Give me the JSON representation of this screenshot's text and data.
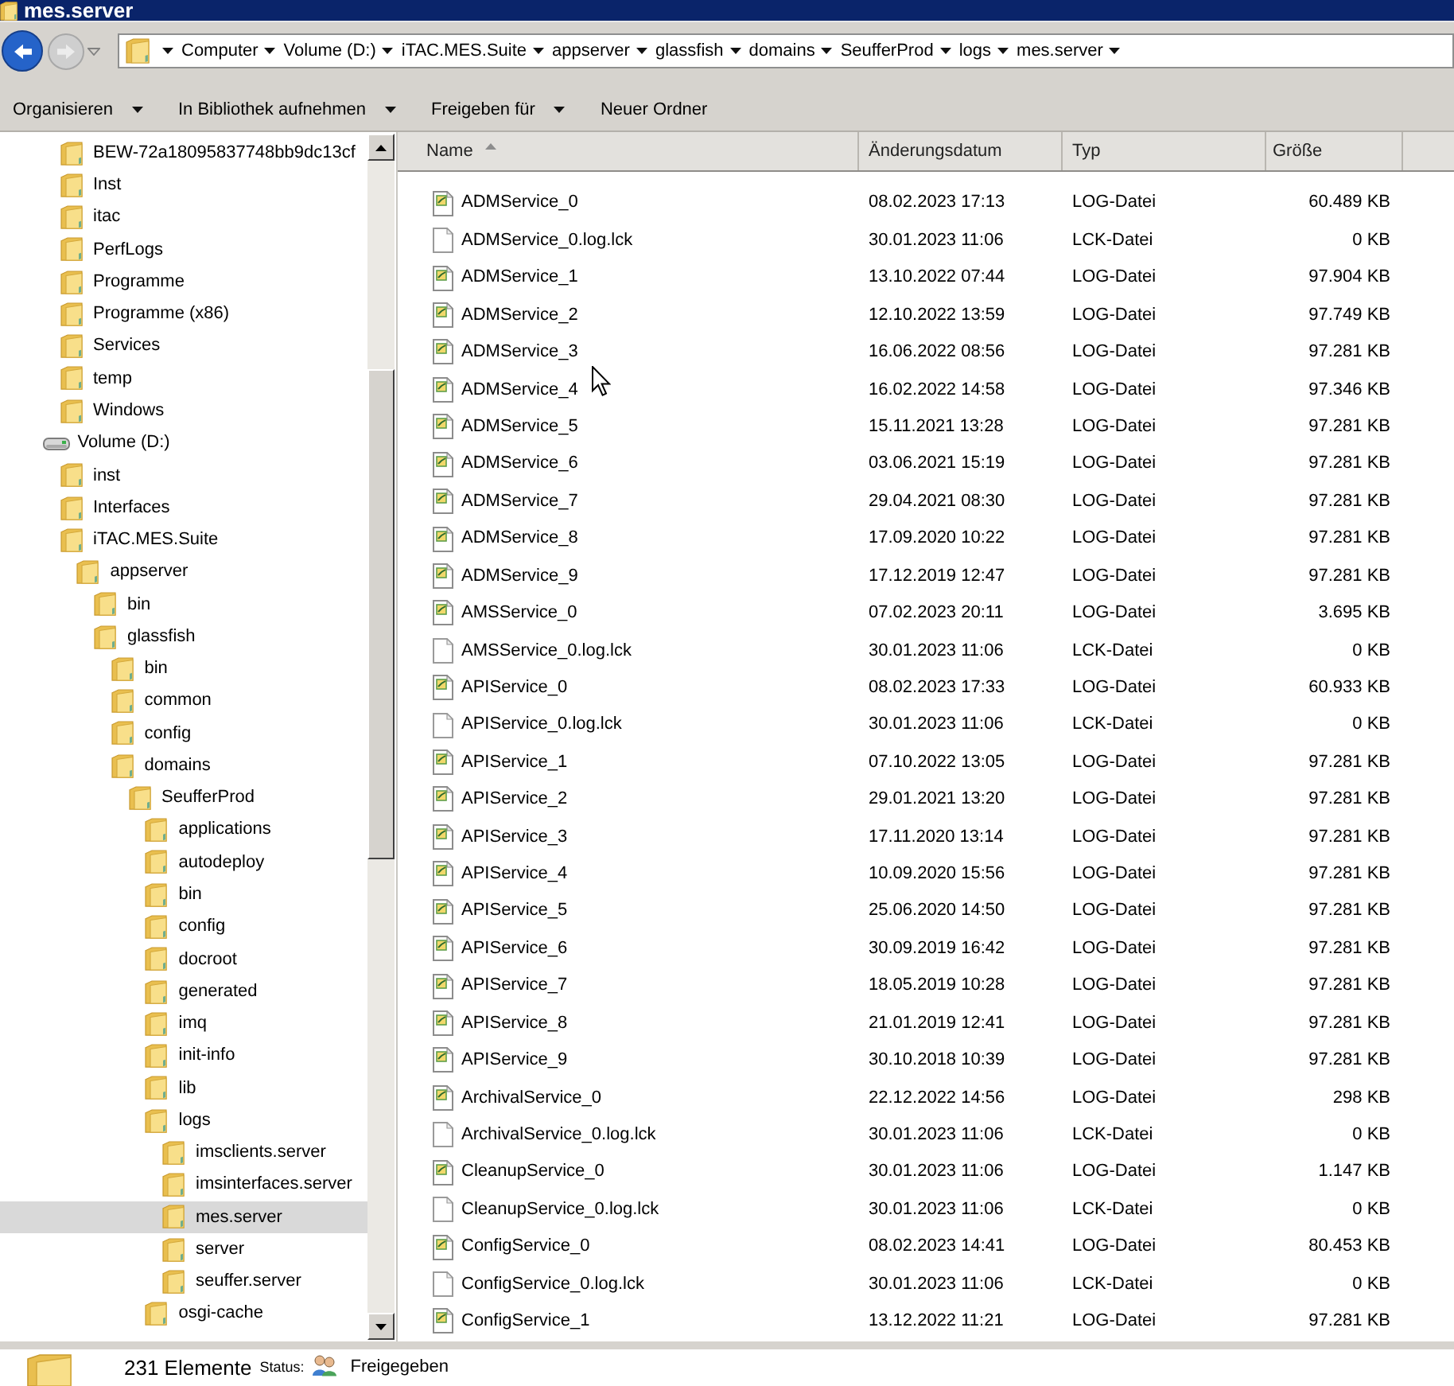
{
  "window": {
    "title": "mes.server"
  },
  "navigation": {
    "back": {
      "disabled": false
    },
    "forward": {
      "disabled": true
    }
  },
  "address_bar": {
    "breadcrumbs": [
      "Computer",
      "Volume (D:)",
      "iTAC.MES.Suite",
      "appserver",
      "glassfish",
      "domains",
      "SeufferProd",
      "logs",
      "mes.server"
    ]
  },
  "toolbar": [
    {
      "label": "Organisieren",
      "dropdown": true
    },
    {
      "label": "In Bibliothek aufnehmen",
      "dropdown": true
    },
    {
      "label": "Freigeben für",
      "dropdown": true
    },
    {
      "label": "Neuer Ordner",
      "dropdown": false
    }
  ],
  "navigation_pane": {
    "partial_children": [
      {
        "label": "BEW-72a18095837748bb9dc13cf",
        "kind": "folder",
        "selected": false
      },
      {
        "label": "Inst",
        "kind": "folder",
        "selected": false
      },
      {
        "label": "itac",
        "kind": "folder",
        "selected": false
      },
      {
        "label": "PerfLogs",
        "kind": "folder",
        "selected": false
      },
      {
        "label": "Programme",
        "kind": "folder",
        "selected": false
      },
      {
        "label": "Programme (x86)",
        "kind": "folder",
        "selected": false
      },
      {
        "label": "Services",
        "kind": "folder",
        "selected": false
      },
      {
        "label": "temp",
        "kind": "folder",
        "selected": false
      },
      {
        "label": "Windows",
        "kind": "folder",
        "selected": false
      }
    ],
    "items": [
      {
        "label": "Volume (D:)",
        "kind": "drive",
        "selected": false,
        "children": [
          {
            "label": "inst",
            "kind": "folder",
            "selected": false
          },
          {
            "label": "Interfaces",
            "kind": "folder",
            "selected": false
          },
          {
            "label": "iTAC.MES.Suite",
            "kind": "folder",
            "selected": false,
            "children": [
              {
                "label": "appserver",
                "kind": "folder",
                "selected": false,
                "children": [
                  {
                    "label": "bin",
                    "kind": "folder",
                    "selected": false
                  },
                  {
                    "label": "glassfish",
                    "kind": "folder",
                    "selected": false,
                    "children": [
                      {
                        "label": "bin",
                        "kind": "folder",
                        "selected": false
                      },
                      {
                        "label": "common",
                        "kind": "folder",
                        "selected": false
                      },
                      {
                        "label": "config",
                        "kind": "folder",
                        "selected": false
                      },
                      {
                        "label": "domains",
                        "kind": "folder",
                        "selected": false,
                        "children": [
                          {
                            "label": "SeufferProd",
                            "kind": "folder",
                            "selected": false,
                            "children": [
                              {
                                "label": "applications",
                                "kind": "folder",
                                "selected": false
                              },
                              {
                                "label": "autodeploy",
                                "kind": "folder",
                                "selected": false
                              },
                              {
                                "label": "bin",
                                "kind": "folder",
                                "selected": false
                              },
                              {
                                "label": "config",
                                "kind": "folder",
                                "selected": false
                              },
                              {
                                "label": "docroot",
                                "kind": "folder",
                                "selected": false
                              },
                              {
                                "label": "generated",
                                "kind": "folder",
                                "selected": false
                              },
                              {
                                "label": "imq",
                                "kind": "folder",
                                "selected": false
                              },
                              {
                                "label": "init-info",
                                "kind": "folder",
                                "selected": false
                              },
                              {
                                "label": "lib",
                                "kind": "folder",
                                "selected": false
                              },
                              {
                                "label": "logs",
                                "kind": "folder",
                                "selected": false,
                                "children": [
                                  {
                                    "label": "imsclients.server",
                                    "kind": "folder",
                                    "selected": false
                                  },
                                  {
                                    "label": "imsinterfaces.server",
                                    "kind": "folder",
                                    "selected": false
                                  },
                                  {
                                    "label": "mes.server",
                                    "kind": "folder",
                                    "selected": true
                                  },
                                  {
                                    "label": "server",
                                    "kind": "folder",
                                    "selected": false
                                  },
                                  {
                                    "label": "seuffer.server",
                                    "kind": "folder",
                                    "selected": false
                                  }
                                ]
                              },
                              {
                                "label": "osgi-cache",
                                "kind": "folder",
                                "selected": false
                              }
                            ]
                          }
                        ]
                      }
                    ]
                  }
                ]
              }
            ]
          }
        ]
      }
    ]
  },
  "file_list": {
    "columns": [
      {
        "label": "Name",
        "sorted": true
      },
      {
        "label": "Änderungsdatum",
        "sorted": false
      },
      {
        "label": "Typ",
        "sorted": false
      },
      {
        "label": "Größe",
        "sorted": false
      }
    ],
    "rows": [
      {
        "kind": "log",
        "name": "ADMService_0",
        "modified": "08.02.2023 17:13",
        "type": "LOG-Datei",
        "size": "60.489 KB"
      },
      {
        "kind": "lock",
        "name": "ADMService_0.log.lck",
        "modified": "30.01.2023 11:06",
        "type": "LCK-Datei",
        "size": "0 KB"
      },
      {
        "kind": "log",
        "name": "ADMService_1",
        "modified": "13.10.2022 07:44",
        "type": "LOG-Datei",
        "size": "97.904 KB"
      },
      {
        "kind": "log",
        "name": "ADMService_2",
        "modified": "12.10.2022 13:59",
        "type": "LOG-Datei",
        "size": "97.749 KB"
      },
      {
        "kind": "log",
        "name": "ADMService_3",
        "modified": "16.06.2022 08:56",
        "type": "LOG-Datei",
        "size": "97.281 KB"
      },
      {
        "kind": "log",
        "name": "ADMService_4",
        "modified": "16.02.2022 14:58",
        "type": "LOG-Datei",
        "size": "97.346 KB"
      },
      {
        "kind": "log",
        "name": "ADMService_5",
        "modified": "15.11.2021 13:28",
        "type": "LOG-Datei",
        "size": "97.281 KB"
      },
      {
        "kind": "log",
        "name": "ADMService_6",
        "modified": "03.06.2021 15:19",
        "type": "LOG-Datei",
        "size": "97.281 KB"
      },
      {
        "kind": "log",
        "name": "ADMService_7",
        "modified": "29.04.2021 08:30",
        "type": "LOG-Datei",
        "size": "97.281 KB"
      },
      {
        "kind": "log",
        "name": "ADMService_8",
        "modified": "17.09.2020 10:22",
        "type": "LOG-Datei",
        "size": "97.281 KB"
      },
      {
        "kind": "log",
        "name": "ADMService_9",
        "modified": "17.12.2019 12:47",
        "type": "LOG-Datei",
        "size": "97.281 KB"
      },
      {
        "kind": "log",
        "name": "AMSService_0",
        "modified": "07.02.2023 20:11",
        "type": "LOG-Datei",
        "size": "3.695 KB"
      },
      {
        "kind": "lock",
        "name": "AMSService_0.log.lck",
        "modified": "30.01.2023 11:06",
        "type": "LCK-Datei",
        "size": "0 KB"
      },
      {
        "kind": "log",
        "name": "APIService_0",
        "modified": "08.02.2023 17:33",
        "type": "LOG-Datei",
        "size": "60.933 KB"
      },
      {
        "kind": "lock",
        "name": "APIService_0.log.lck",
        "modified": "30.01.2023 11:06",
        "type": "LCK-Datei",
        "size": "0 KB"
      },
      {
        "kind": "log",
        "name": "APIService_1",
        "modified": "07.10.2022 13:05",
        "type": "LOG-Datei",
        "size": "97.281 KB"
      },
      {
        "kind": "log",
        "name": "APIService_2",
        "modified": "29.01.2021 13:20",
        "type": "LOG-Datei",
        "size": "97.281 KB"
      },
      {
        "kind": "log",
        "name": "APIService_3",
        "modified": "17.11.2020 13:14",
        "type": "LOG-Datei",
        "size": "97.281 KB"
      },
      {
        "kind": "log",
        "name": "APIService_4",
        "modified": "10.09.2020 15:56",
        "type": "LOG-Datei",
        "size": "97.281 KB"
      },
      {
        "kind": "log",
        "name": "APIService_5",
        "modified": "25.06.2020 14:50",
        "type": "LOG-Datei",
        "size": "97.281 KB"
      },
      {
        "kind": "log",
        "name": "APIService_6",
        "modified": "30.09.2019 16:42",
        "type": "LOG-Datei",
        "size": "97.281 KB"
      },
      {
        "kind": "log",
        "name": "APIService_7",
        "modified": "18.05.2019 10:28",
        "type": "LOG-Datei",
        "size": "97.281 KB"
      },
      {
        "kind": "log",
        "name": "APIService_8",
        "modified": "21.01.2019 12:41",
        "type": "LOG-Datei",
        "size": "97.281 KB"
      },
      {
        "kind": "log",
        "name": "APIService_9",
        "modified": "30.10.2018 10:39",
        "type": "LOG-Datei",
        "size": "97.281 KB"
      },
      {
        "kind": "log",
        "name": "ArchivalService_0",
        "modified": "22.12.2022 14:56",
        "type": "LOG-Datei",
        "size": "298 KB"
      },
      {
        "kind": "lock",
        "name": "ArchivalService_0.log.lck",
        "modified": "30.01.2023 11:06",
        "type": "LCK-Datei",
        "size": "0 KB"
      },
      {
        "kind": "log",
        "name": "CleanupService_0",
        "modified": "30.01.2023 11:06",
        "type": "LOG-Datei",
        "size": "1.147 KB"
      },
      {
        "kind": "lock",
        "name": "CleanupService_0.log.lck",
        "modified": "30.01.2023 11:06",
        "type": "LCK-Datei",
        "size": "0 KB"
      },
      {
        "kind": "log",
        "name": "ConfigService_0",
        "modified": "08.02.2023 14:41",
        "type": "LOG-Datei",
        "size": "80.453 KB"
      },
      {
        "kind": "lock",
        "name": "ConfigService_0.log.lck",
        "modified": "30.01.2023 11:06",
        "type": "LCK-Datei",
        "size": "0 KB"
      },
      {
        "kind": "log",
        "name": "ConfigService_1",
        "modified": "13.12.2022 11:21",
        "type": "LOG-Datei",
        "size": "97.281 KB"
      }
    ]
  },
  "status_bar": {
    "item_count": "231 Elemente",
    "status_label": "Status:",
    "status_value": "Freigegeben"
  }
}
